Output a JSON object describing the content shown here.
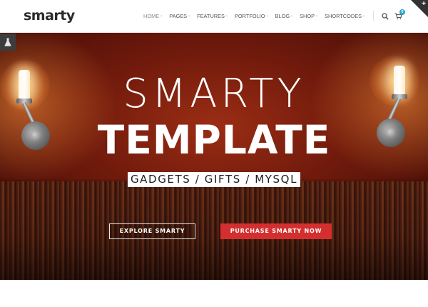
{
  "header": {
    "logo": "smarty",
    "nav": [
      {
        "label": "HOME"
      },
      {
        "label": "PAGES"
      },
      {
        "label": "FEATURES"
      },
      {
        "label": "PORTFOLIO"
      },
      {
        "label": "BLOG"
      },
      {
        "label": "SHOP"
      },
      {
        "label": "SHORTCODES"
      }
    ],
    "nav_caret": "›",
    "cart_count": "0",
    "corner_symbol": "+",
    "icons": [
      "search-icon",
      "cart-icon",
      "flask-icon"
    ]
  },
  "hero": {
    "title_line1": "SMARTY",
    "title_line2": "TEMPLATE",
    "tagline": "GADGETS / GIFTS / MYSQL",
    "explore_button": "EXPLORE SMARTY",
    "purchase_button": "PURCHASE SMARTY NOW"
  },
  "colors": {
    "accent": "#d42f2f",
    "badge": "#2aa6c9",
    "hero_red": "#701a0c"
  }
}
